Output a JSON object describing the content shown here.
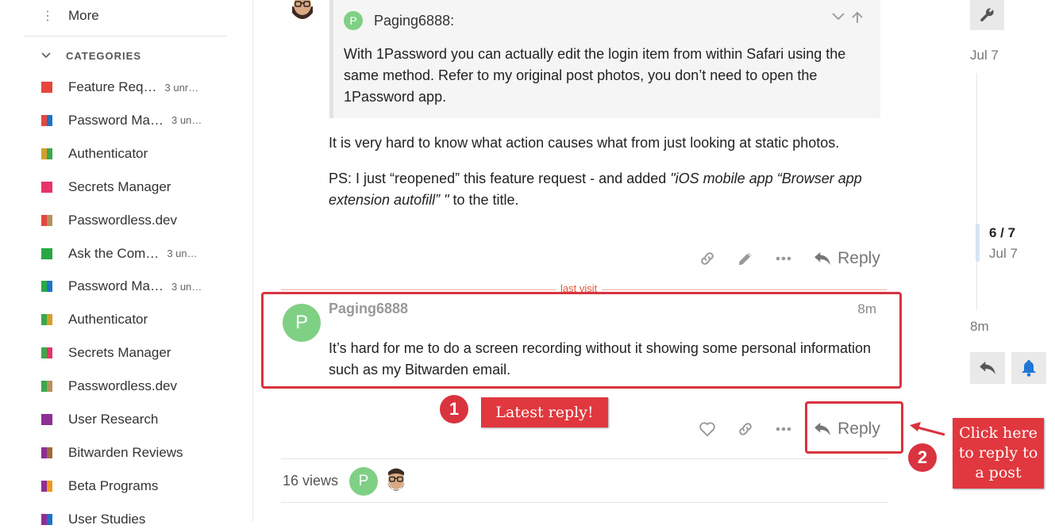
{
  "sidebar": {
    "more_label": "More",
    "categories_header": "CATEGORIES",
    "categories": [
      {
        "name": "Feature Req…",
        "count": "3 unr…",
        "colors": [
          "#e5473d",
          "#e5473d"
        ]
      },
      {
        "name": "Password Ma…",
        "count": "3 un…",
        "colors": [
          "#e5473d",
          "#1e73c8"
        ]
      },
      {
        "name": "Authenticator",
        "count": "",
        "colors": [
          "#d4a02b",
          "#3aa84a"
        ]
      },
      {
        "name": "Secrets Manager",
        "count": "",
        "colors": [
          "#e8336b",
          "#e8336b"
        ]
      },
      {
        "name": "Passwordless.dev",
        "count": "",
        "colors": [
          "#e5473d",
          "#b89060"
        ]
      },
      {
        "name": "Ask the Com…",
        "count": "3 un…",
        "colors": [
          "#27a844",
          "#27a844"
        ]
      },
      {
        "name": "Password Ma…",
        "count": "3 un…",
        "colors": [
          "#27a844",
          "#1e73c8"
        ]
      },
      {
        "name": "Authenticator",
        "count": "",
        "colors": [
          "#3aa84a",
          "#d4a02b"
        ]
      },
      {
        "name": "Secrets Manager",
        "count": "",
        "colors": [
          "#3aa84a",
          "#e8336b"
        ]
      },
      {
        "name": "Passwordless.dev",
        "count": "",
        "colors": [
          "#3aa84a",
          "#b89060"
        ]
      },
      {
        "name": "User Research",
        "count": "",
        "colors": [
          "#8e2f96",
          "#8e2f96"
        ]
      },
      {
        "name": "Bitwarden Reviews",
        "count": "",
        "colors": [
          "#8e2f96",
          "#a36a3a"
        ]
      },
      {
        "name": "Beta Programs",
        "count": "",
        "colors": [
          "#8e2f96",
          "#f29a1a"
        ]
      },
      {
        "name": "User Studies",
        "count": "",
        "colors": [
          "#8e2f96",
          "#1e73c8"
        ]
      }
    ]
  },
  "quote": {
    "avatar_letter": "P",
    "username": "Paging6888:",
    "text": "With 1Password you can actually edit the login item from within Safari using the same method. Refer to my original post photos, you don’t need to open the 1Password app."
  },
  "previous_post": {
    "paragraph1": "It is very hard to know what action causes what from just looking at static photos.",
    "ps_prefix": "PS: I just “reopened” this feature request - and added ",
    "ps_italic": "\"iOS mobile app “Browser app extension autofill” \"",
    "ps_suffix": " to the title.",
    "reply_label": "Reply"
  },
  "last_visit_label": "last visit",
  "latest_post": {
    "avatar_letter": "P",
    "username": "Paging6888",
    "time": "8m",
    "text": "It’s hard for me to do a screen recording without it showing some personal information such as my Bitwarden email.",
    "reply_label": "Reply"
  },
  "annotations": {
    "badge1": "1",
    "badge2": "2",
    "callout1": "Latest reply!",
    "callout2": "Click here to reply to a post"
  },
  "topic_footer": {
    "views": "16 views",
    "participant_letter": "P"
  },
  "timeline": {
    "start_date": "Jul 7",
    "position": "6 / 7",
    "position_date": "Jul 7",
    "end_label": "8m"
  },
  "colors": {
    "accent_red": "#d9333f",
    "avatar_green": "#7fd084",
    "notification_blue": "#1f77d6"
  }
}
